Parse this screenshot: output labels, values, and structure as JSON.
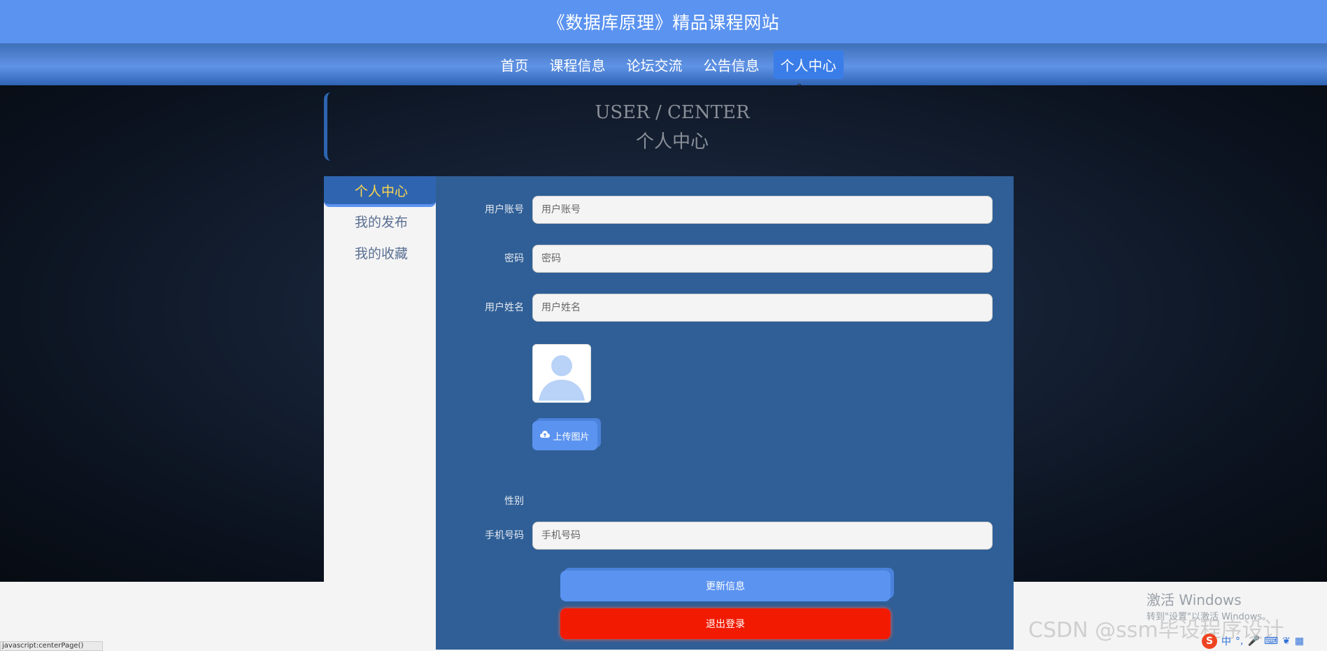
{
  "site": {
    "title": "《数据库原理》精品课程网站"
  },
  "nav": {
    "items": [
      {
        "label": "首页"
      },
      {
        "label": "课程信息"
      },
      {
        "label": "论坛交流"
      },
      {
        "label": "公告信息"
      },
      {
        "label": "个人中心",
        "active": true
      }
    ]
  },
  "header": {
    "title_en": "USER / CENTER",
    "title_cn": "个人中心"
  },
  "sidebar": {
    "items": [
      {
        "label": "个人中心",
        "active": true
      },
      {
        "label": "我的发布"
      },
      {
        "label": "我的收藏"
      }
    ]
  },
  "form": {
    "account": {
      "label": "用户账号",
      "placeholder": "用户账号",
      "value": ""
    },
    "password": {
      "label": "密码",
      "placeholder": "密码",
      "value": ""
    },
    "name": {
      "label": "用户姓名",
      "placeholder": "用户姓名",
      "value": ""
    },
    "upload_label": "上传图片",
    "gender": {
      "label": "性别"
    },
    "phone": {
      "label": "手机号码",
      "placeholder": "手机号码",
      "value": ""
    },
    "update_label": "更新信息",
    "logout_label": "退出登录"
  },
  "overlays": {
    "watermark": "CSDN @ssm毕设程序设计",
    "windows_activation_title": "激活 Windows",
    "windows_activation_sub": "转到\"设置\"以激活 Windows。",
    "status_url": "javascript:centerPage()",
    "ime_label": "中"
  },
  "colors": {
    "primary": "#5b93f0",
    "panel": "#2f5f96",
    "logout": "#f21a00",
    "sidebar_active_text": "#ffd94d"
  }
}
